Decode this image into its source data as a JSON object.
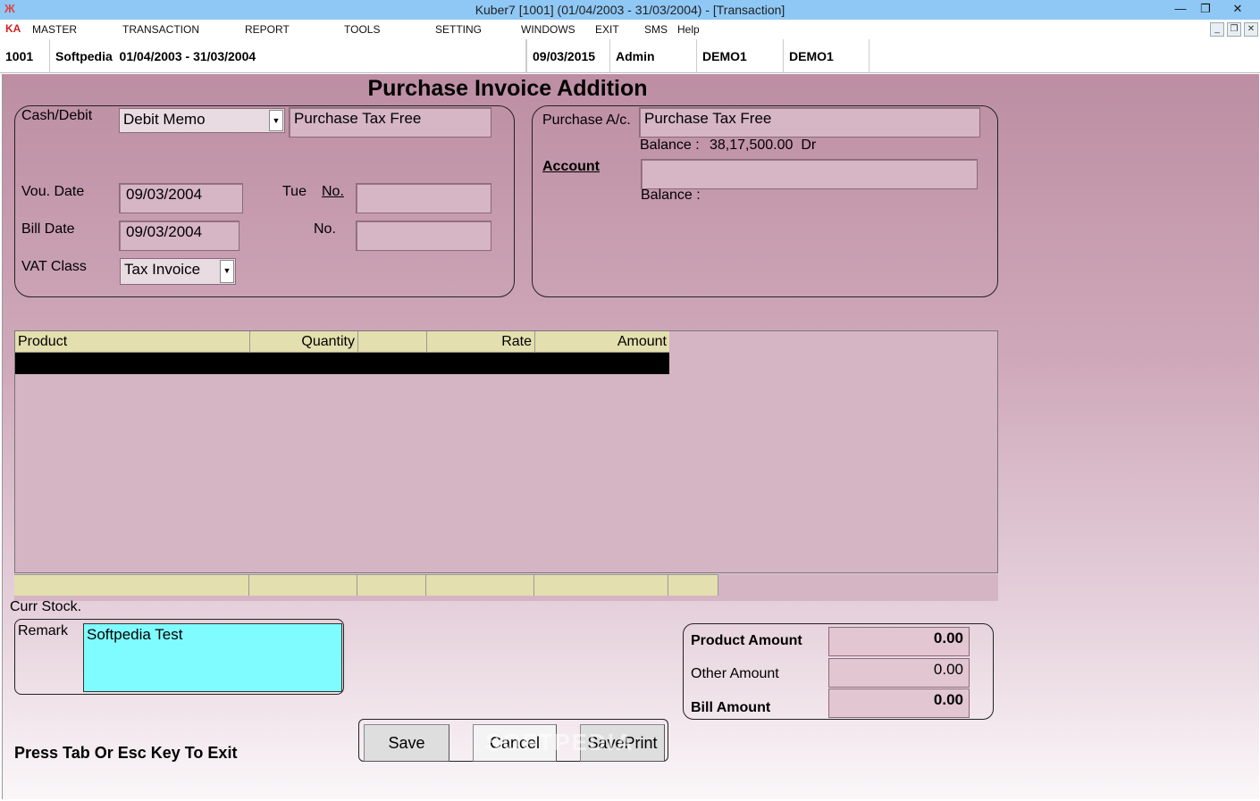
{
  "window": {
    "title": "Kuber7 [1001] (01/04/2003 - 31/03/2004) - [Transaction]",
    "minimize": "—",
    "restore": "❐",
    "close": "✕",
    "app_icon": "Ж"
  },
  "menu": {
    "logo": "KA",
    "items": [
      "MASTER",
      "TRANSACTION",
      "REPORT",
      "TOOLS",
      "SETTING",
      "WINDOWS",
      "EXIT",
      "SMS",
      "Help"
    ],
    "mdi_minimize": "_",
    "mdi_restore": "❐",
    "mdi_close": "✕"
  },
  "status": {
    "company_id": "1001",
    "company_info": "Softpedia  01/04/2003 - 31/03/2004",
    "date": "09/03/2015",
    "user": "Admin",
    "db1": "DEMO1",
    "db2": "DEMO1"
  },
  "form": {
    "title": "Purchase Invoice Addition",
    "cash_debit_label": "Cash/Debit",
    "cash_debit_value": "Debit Memo",
    "tax_type": "Purchase Tax Free",
    "vou_date_label": "Vou. Date",
    "vou_date": "09/03/2004",
    "day": "Tue",
    "no_label": "No.",
    "vou_no": "",
    "bill_date_label": "Bill Date",
    "bill_date": "09/03/2004",
    "bill_no_label": "No.",
    "bill_no": "",
    "vat_class_label": "VAT Class",
    "vat_class": "Tax Invoice",
    "purchase_ac_label": "Purchase A/c.",
    "purchase_ac": "Purchase Tax Free",
    "balance_label": "Balance :",
    "balance_value": "38,17,500.00  Dr",
    "account_label": "Account",
    "account_value": "",
    "account_balance_label": "Balance :"
  },
  "grid": {
    "columns": [
      "Product",
      "Quantity",
      "",
      "Rate",
      "Amount"
    ]
  },
  "bottom": {
    "curr_stock_label": "Curr Stock.",
    "remark_label": "Remark",
    "remark_value": "Softpedia Test",
    "product_amount_label": "Product Amount",
    "product_amount": "0.00",
    "other_amount_label": "Other Amount",
    "other_amount": "0.00",
    "bill_amount_label": "Bill Amount",
    "bill_amount": "0.00",
    "save": "Save",
    "cancel": "Cancel",
    "saveprint": "SavePrint",
    "hint": "Press Tab Or Esc Key To Exit",
    "watermark": "SOFTPEDIA"
  }
}
